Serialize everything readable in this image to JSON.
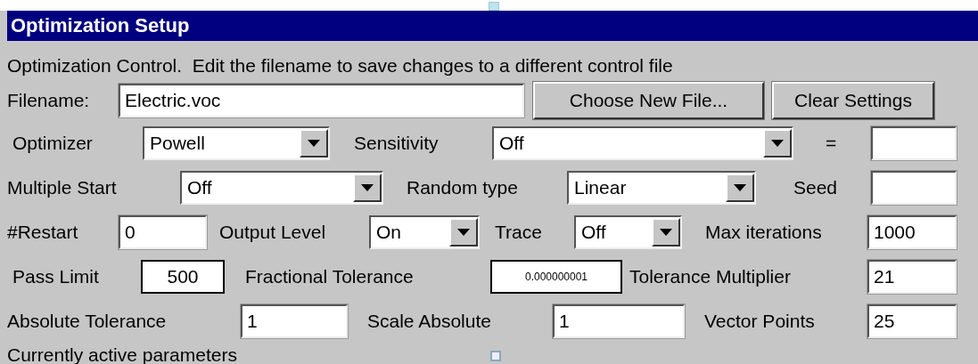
{
  "window": {
    "title": "Optimization Setup"
  },
  "description": "Optimization Control.  Edit the filename to save changes to a different control file",
  "filename": {
    "label": "Filename:",
    "value": "Electric.voc"
  },
  "buttons": [
    "Choose New File...",
    "Clear Settings"
  ],
  "rows": [
    [
      {
        "kind": "label",
        "text": "Optimizer"
      },
      {
        "kind": "select",
        "value": "Powell"
      },
      {
        "kind": "label",
        "text": "Sensitivity"
      },
      {
        "kind": "select",
        "value": "Off"
      },
      {
        "kind": "label",
        "text": "="
      },
      {
        "kind": "field"
      }
    ],
    [
      {
        "kind": "label",
        "text": "Multiple Start"
      },
      {
        "kind": "select",
        "value": "Off"
      },
      {
        "kind": "label",
        "text": "Random type"
      },
      {
        "kind": "select",
        "value": "Linear"
      },
      {
        "kind": "label",
        "text": "Seed"
      },
      {
        "kind": "field"
      }
    ],
    [
      {
        "kind": "label",
        "text": "#Restart"
      },
      {
        "kind": "field",
        "value": "0"
      },
      {
        "kind": "label",
        "text": "Output Level"
      },
      {
        "kind": "select",
        "value": "On"
      },
      {
        "kind": "label",
        "text": "Trace"
      },
      {
        "kind": "select",
        "value": "Off"
      },
      {
        "kind": "label",
        "text": "Max iterations"
      },
      {
        "kind": "field",
        "value": "1000"
      }
    ],
    [
      {
        "kind": "label",
        "text": "Pass Limit"
      },
      {
        "kind": "framed-field",
        "value": "500"
      },
      {
        "kind": "label",
        "text": "Fractional Tolerance"
      },
      {
        "kind": "framed-field-small",
        "value": "0.000000001"
      },
      {
        "kind": "label",
        "text": "Tolerance Multiplier"
      },
      {
        "kind": "field",
        "value": "21"
      }
    ],
    [
      {
        "kind": "label",
        "text": "Absolute Tolerance"
      },
      {
        "kind": "field",
        "value": "1"
      },
      {
        "kind": "label",
        "text": "Scale Absolute"
      },
      {
        "kind": "field",
        "value": "1"
      },
      {
        "kind": "label",
        "text": "Vector Points"
      },
      {
        "kind": "field",
        "value": "25"
      }
    ]
  ],
  "footer": "Currently active parameters"
}
